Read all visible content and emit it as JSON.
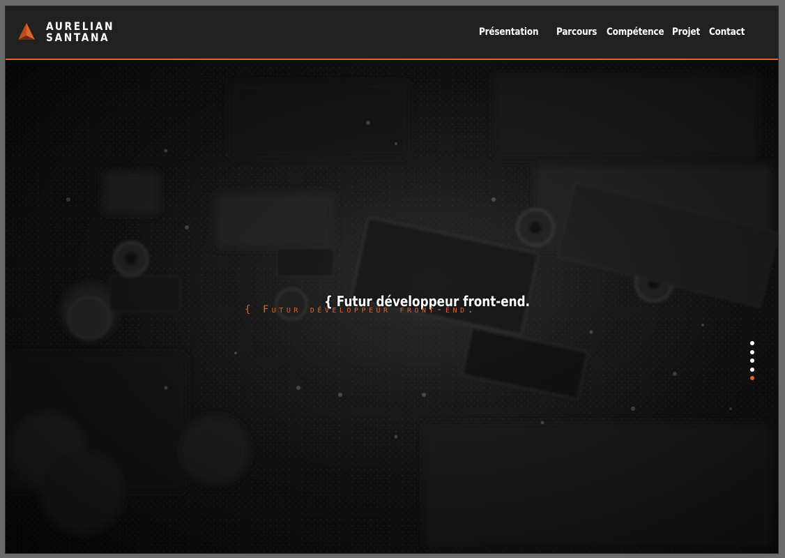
{
  "brand": {
    "line1": "AURELIAN",
    "line2": "SANTANA",
    "logo_icon": "orange-triangle-logo",
    "accent_color": "#e0632a"
  },
  "nav": {
    "items": [
      {
        "label": "Présentation"
      },
      {
        "label": "Parcours"
      },
      {
        "label": "Compétence"
      },
      {
        "label": "Projet"
      },
      {
        "label": "Contact"
      }
    ]
  },
  "hero": {
    "tagline": "{ Futur développeur front-end.",
    "tagline_echo": "{ Futur développeur front-end.",
    "background": "circuit-board-photo"
  },
  "pagination": {
    "count": 5,
    "active_index": 4
  }
}
